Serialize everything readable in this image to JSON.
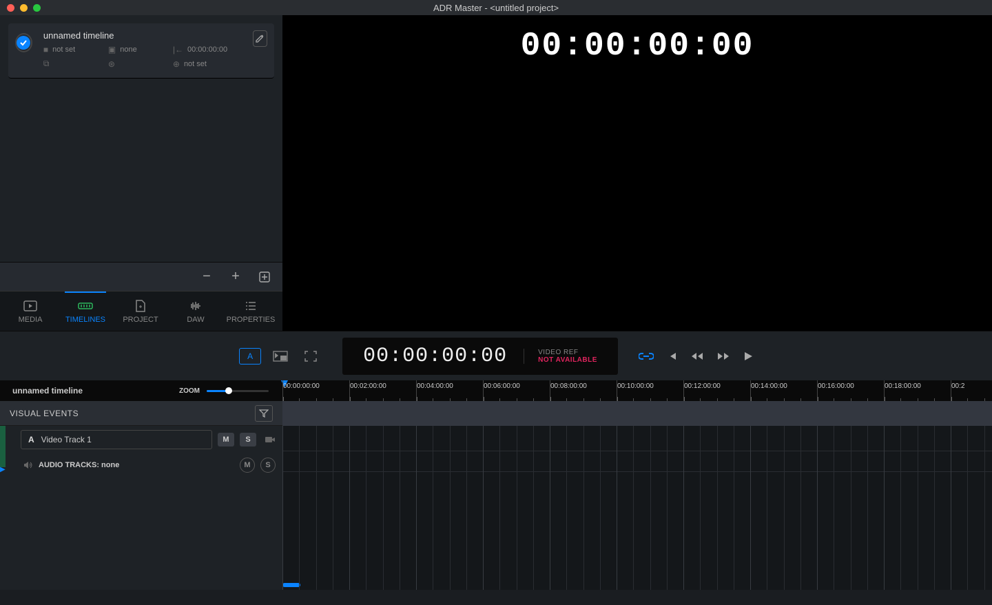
{
  "titlebar": {
    "title": "ADR Master - <untitled project>"
  },
  "timeline_card": {
    "name": "unnamed timeline",
    "field_notset": "not set",
    "field_none": "none",
    "field_tc": "00:00:00:00",
    "field_notset2": "not set"
  },
  "tabs": {
    "media": "MEDIA",
    "timelines": "TIMELINES",
    "project": "PROJECT",
    "daw": "DAW",
    "properties": "PROPERTIES"
  },
  "video": {
    "big_timecode": "00:00:00:00"
  },
  "transport": {
    "a_label": "A",
    "tc": "00:00:00:00",
    "ref_label": "VIDEO REF",
    "ref_status": "NOT AVAILABLE"
  },
  "timeline_header": {
    "name": "unnamed timeline",
    "zoom_label": "ZOOM",
    "ticks": [
      "00:00:00:00",
      "00:02:00:00",
      "00:04:00:00",
      "00:06:00:00",
      "00:08:00:00",
      "00:10:00:00",
      "00:12:00:00",
      "00:14:00:00",
      "00:16:00:00",
      "00:18:00:00",
      "00:2"
    ]
  },
  "visual_events": {
    "label": "VISUAL EVENTS"
  },
  "tracks": {
    "video_letter": "A",
    "video_name": "Video Track 1",
    "m": "M",
    "s": "S",
    "audio_label": "AUDIO TRACKS: none"
  }
}
